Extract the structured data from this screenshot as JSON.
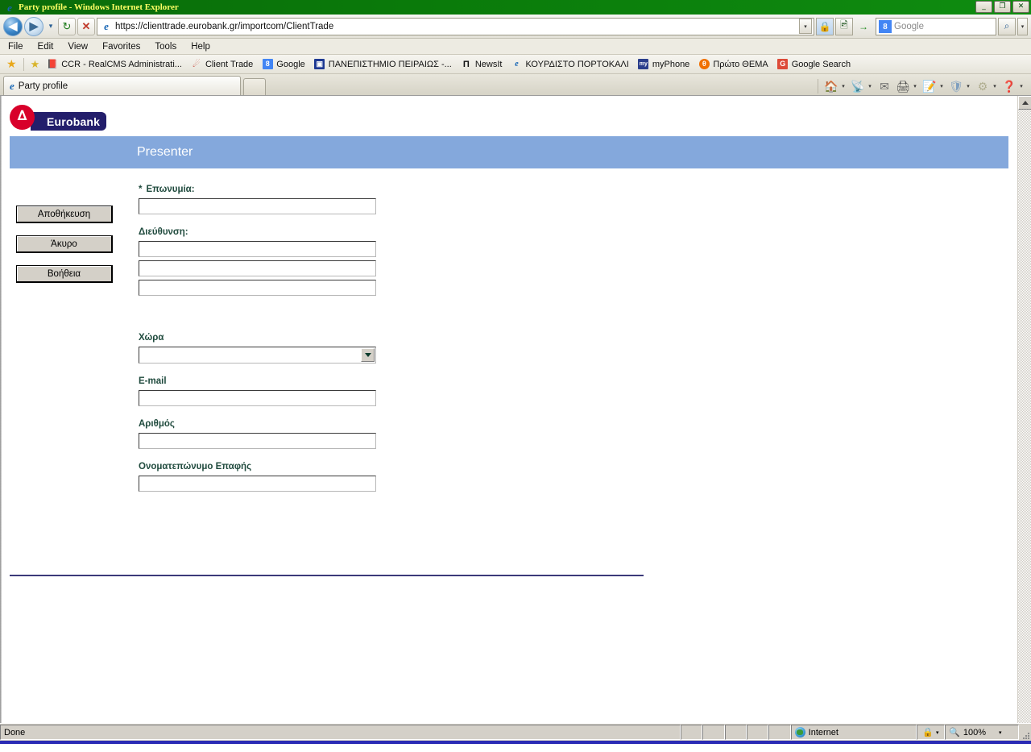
{
  "window": {
    "title": "Party profile - Windows Internet Explorer",
    "icon": "ie-logo-icon",
    "minimize_label": "_",
    "maximize_label": "❐",
    "close_label": "✕"
  },
  "nav": {
    "back_label": "◀",
    "forward_label": "▶",
    "recent_dropdown_label": "▾",
    "refresh_label": "↻",
    "stop_label": "✕",
    "go_label": "→",
    "url": "https://clienttrade.eurobank.gr/importcom/ClientTrade",
    "url_scheme": "https://",
    "url_host": "clienttrade.eurobank.gr",
    "url_path": "/importcom/ClientTrade",
    "url_dropdown_label": "▾",
    "lock_icon": "padlock-icon",
    "compat_icon": "compatibility-view-icon",
    "search_engine_icon": "google-icon",
    "search_engine_letter": "8",
    "search_placeholder": "Google",
    "search_value": "",
    "search_button_label": "⌕",
    "search_dropdown_label": "▾"
  },
  "menubar": {
    "items": [
      {
        "label": "File",
        "accel": "F"
      },
      {
        "label": "Edit",
        "accel": "E"
      },
      {
        "label": "View",
        "accel": "V"
      },
      {
        "label": "Favorites",
        "accel": "a"
      },
      {
        "label": "Tools",
        "accel": "T"
      },
      {
        "label": "Help",
        "accel": "H"
      }
    ]
  },
  "favorites_bar": {
    "favorites_button_icon": "star-icon",
    "add_to_favorites_icon": "add-favorite-icon",
    "items": [
      {
        "label": "CCR - RealCMS Administrati...",
        "icon": "book-icon",
        "color": "#8b1a1a",
        "glyph": "■"
      },
      {
        "label": "Client Trade",
        "icon": "comet-icon",
        "color": "#c0392b",
        "glyph": "☄"
      },
      {
        "label": "Google",
        "icon": "google-icon",
        "color": "#4285f4",
        "glyph": "8"
      },
      {
        "label": "ΠΑΝΕΠΙΣΤΗΜΙΟ ΠΕΙΡΑΙΩΣ -...",
        "icon": "university-icon",
        "color": "#1f3a93",
        "glyph": "▣"
      },
      {
        "label": "NewsIt",
        "icon": "newsit-icon",
        "color": "#111111",
        "glyph": "Π"
      },
      {
        "label": "ΚΟΥΡΔΙΣΤΟ ΠΟΡΤΟΚΑΛΙ",
        "icon": "ie-logo-icon",
        "color": "#1464b4",
        "glyph": "e"
      },
      {
        "label": "myPhone",
        "icon": "myphone-icon",
        "color": "#2b3e8c",
        "glyph": "my"
      },
      {
        "label": "Πρώτο ΘΕΜΑ",
        "icon": "protothema-icon",
        "color": "#f07000",
        "glyph": "θ"
      },
      {
        "label": "Google Search",
        "icon": "google-search-icon",
        "color": "#dd4b39",
        "glyph": "⌘"
      }
    ]
  },
  "tabs": {
    "active_tab_label": "Party profile",
    "active_tab_icon": "ie-logo-icon",
    "new_tab_label": ""
  },
  "command_bar": {
    "items": [
      {
        "name": "home-icon",
        "glyph": "⌂",
        "color": "#2d6ca8",
        "has_dropdown": true
      },
      {
        "name": "feeds-icon",
        "glyph": "◠",
        "color": "#9a9a9a",
        "has_dropdown": true
      },
      {
        "name": "mail-icon",
        "glyph": "✉",
        "color": "#6a6a6a",
        "has_dropdown": false
      },
      {
        "name": "print-icon",
        "glyph": "⎙",
        "color": "#4a4a4a",
        "has_dropdown": true
      },
      {
        "name": "page-icon",
        "glyph": "✎",
        "color": "#3a6a3a",
        "has_dropdown": true
      },
      {
        "name": "safety-icon",
        "glyph": "⛊",
        "color": "#7f9fbf",
        "has_dropdown": true
      },
      {
        "name": "tools-icon",
        "glyph": "⚙",
        "color": "#9a9a7a",
        "has_dropdown": true
      },
      {
        "name": "help-icon",
        "glyph": "?",
        "color": "#1a5a9a",
        "has_dropdown": true
      }
    ]
  },
  "page": {
    "logo": {
      "brand": "Eurobank",
      "mark": "∆",
      "disc_color": "#d8002a",
      "plate_color": "#231e6b"
    },
    "banner": {
      "title": "Presenter",
      "background": "#84a8dc",
      "text_color": "#ffffff"
    },
    "buttons": [
      {
        "label": "Αποθήκευση",
        "name": "save-button"
      },
      {
        "label": "Άκυρο",
        "name": "cancel-button"
      },
      {
        "label": "Βοήθεια",
        "name": "help-button"
      }
    ],
    "fields": [
      {
        "name": "company-name",
        "label": "Επωνυμία:",
        "required": true,
        "required_marker": "*",
        "type": "text",
        "value": "",
        "rows": 1
      },
      {
        "name": "address",
        "label": "Διεύθυνση:",
        "required": false,
        "type": "text",
        "value": "",
        "rows": 3
      },
      {
        "name": "country",
        "label": "Χώρα",
        "required": false,
        "type": "select",
        "value": "",
        "options": []
      },
      {
        "name": "email",
        "label": "E-mail",
        "required": false,
        "type": "text",
        "value": "",
        "rows": 1
      },
      {
        "name": "number",
        "label": "Αριθμός",
        "required": false,
        "type": "text",
        "value": "",
        "rows": 1
      },
      {
        "name": "contact-full-name",
        "label": "Ονοματεπώνυμο Επαφής",
        "required": false,
        "type": "text",
        "value": "",
        "rows": 1
      }
    ],
    "label_color": "#1f4a3d",
    "rule_color": "#3b3a7a"
  },
  "scrollbar": {
    "up_label": "▲",
    "down_label": "▼"
  },
  "statusbar": {
    "status_text": "Done",
    "zone_label": "Internet",
    "zone_icon": "globe-icon",
    "protected_mode_icon": "lock-icon",
    "protected_dropdown": "▾",
    "zoom_icon": "magnifier-icon",
    "zoom_level": "100%",
    "zoom_dropdown": "▾"
  }
}
